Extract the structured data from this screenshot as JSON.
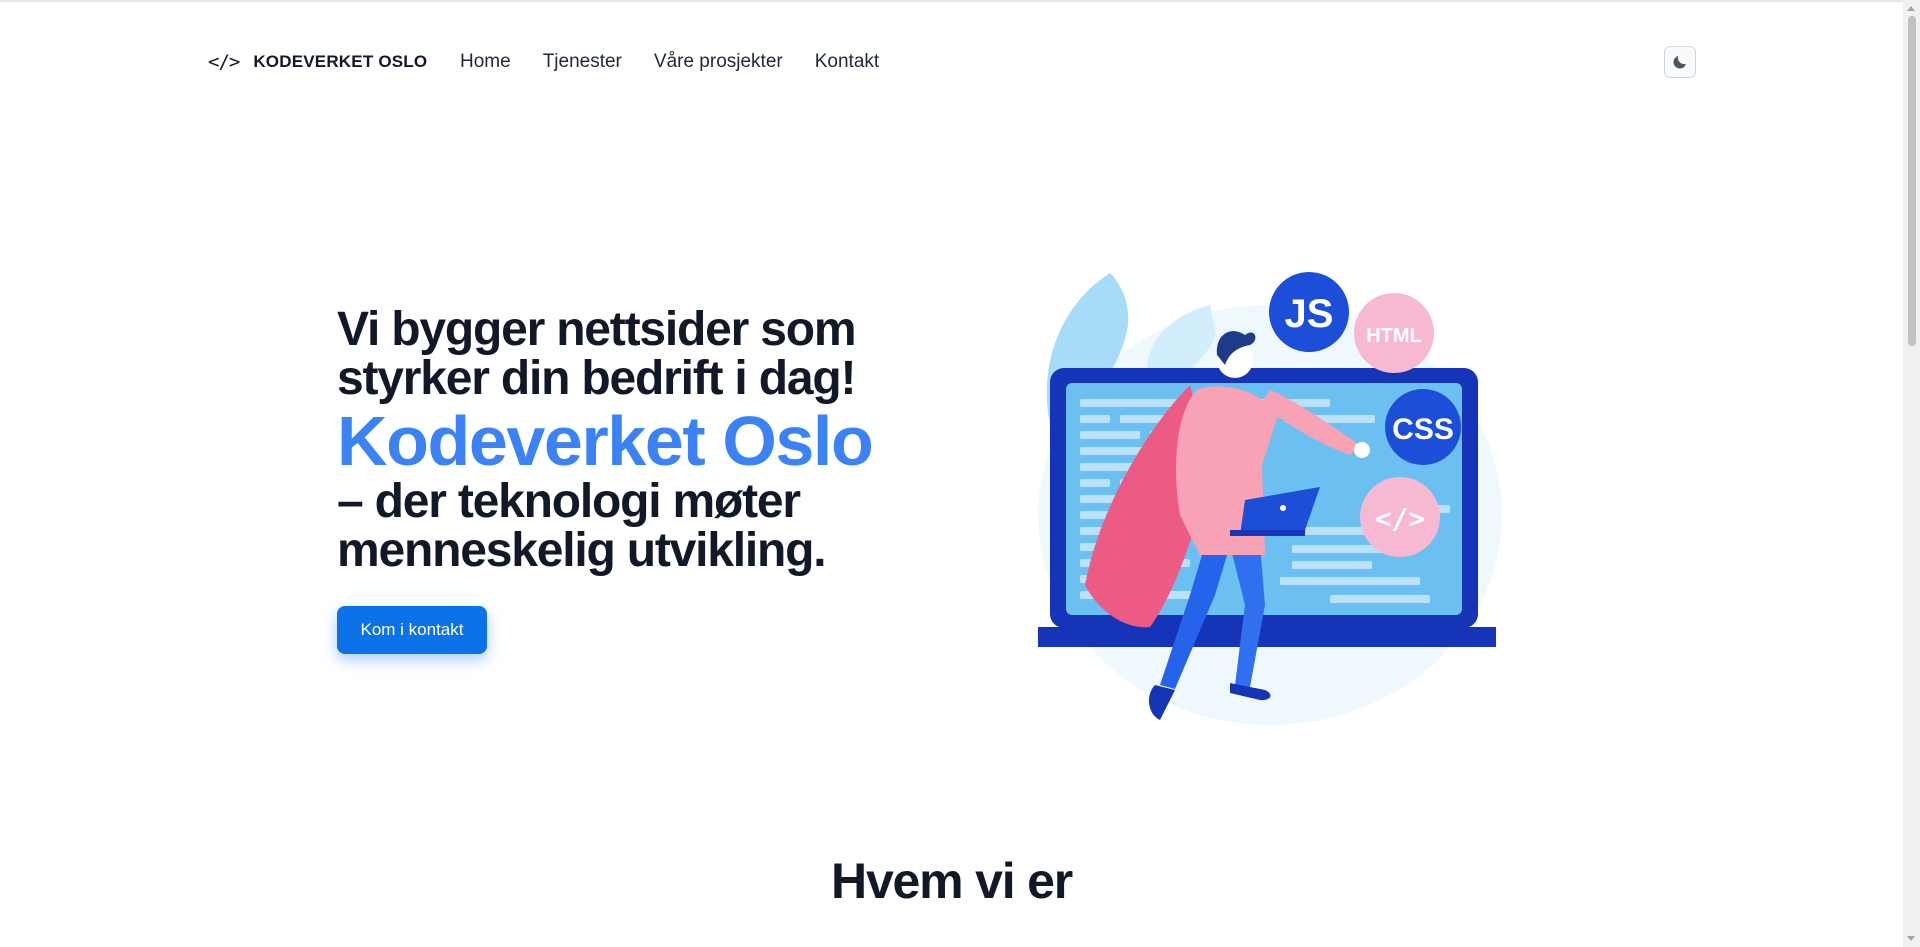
{
  "header": {
    "brand_icon": "</>",
    "brand_name": "KODEVERKET OSLO",
    "nav": [
      "Home",
      "Tjenester",
      "Våre prosjekter",
      "Kontakt"
    ],
    "theme_toggle_icon": "moon-icon"
  },
  "hero": {
    "headline_line1": "Vi bygger nettsider som",
    "headline_line2": "styrker din bedrift i dag!",
    "accent": "Kodeverket Oslo",
    "tagline_line1": "– der teknologi møter",
    "tagline_line2": "menneskelig utvikling.",
    "cta_label": "Kom i kontakt",
    "illustration": {
      "badge_js": "JS",
      "badge_html": "HTML",
      "badge_css": "CSS",
      "badge_code": "</>"
    }
  },
  "section": {
    "title": "Hvem vi er"
  },
  "colors": {
    "accent_text": "#3b82f6",
    "button": "#0b72e7",
    "text": "#111827"
  }
}
